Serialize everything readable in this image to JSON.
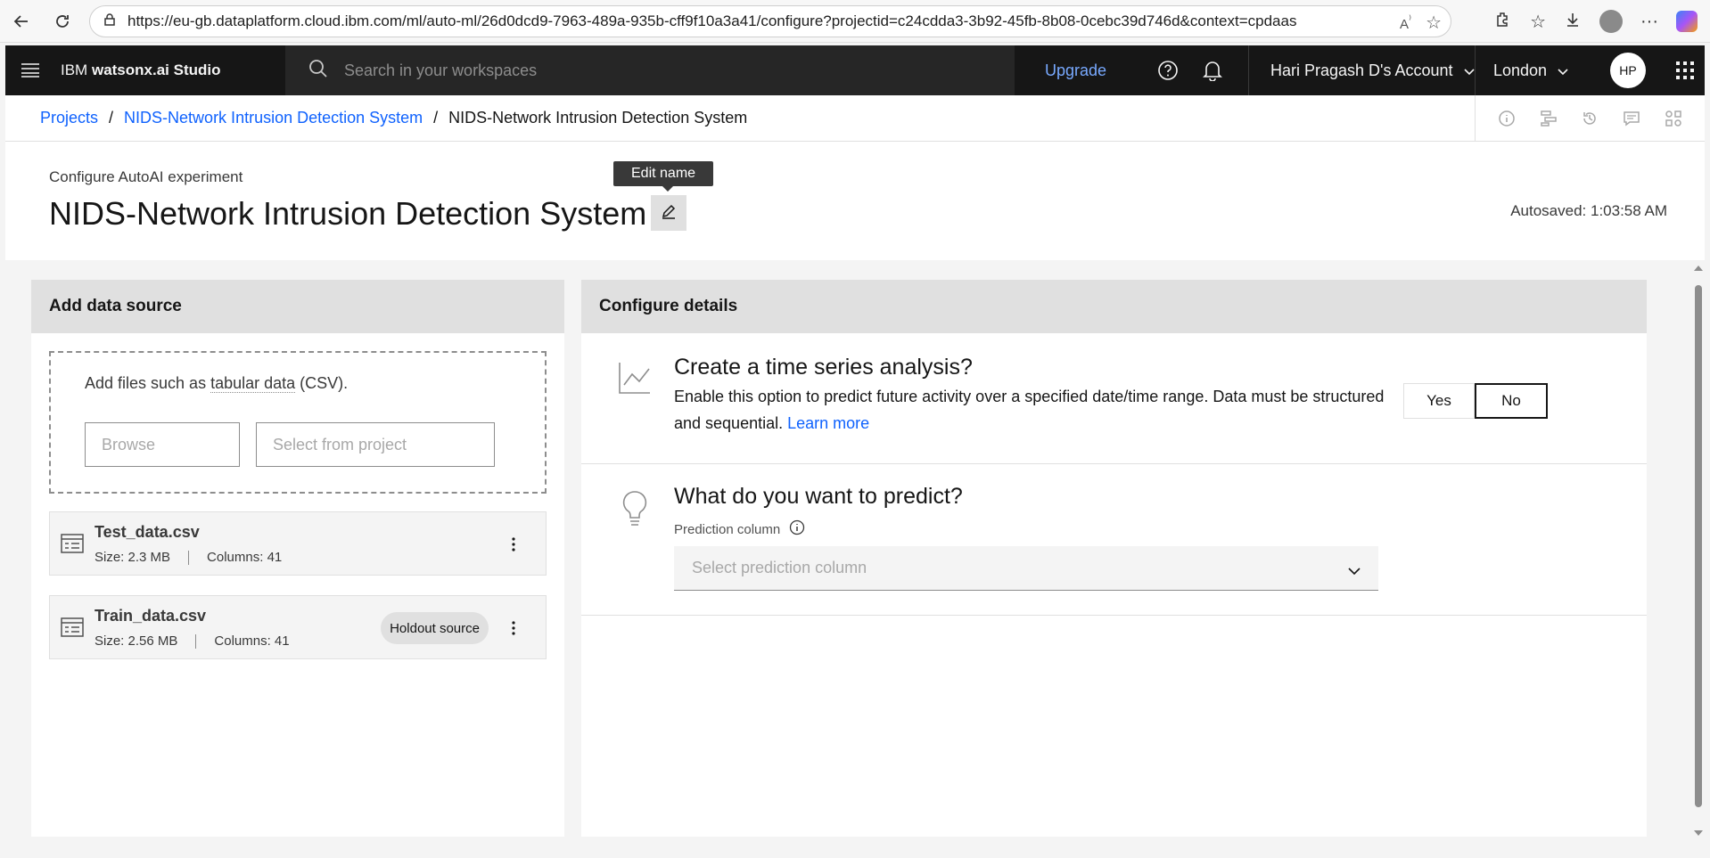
{
  "browser": {
    "url": "https://eu-gb.dataplatform.cloud.ibm.com/ml/auto-ml/26d0dcd9-7963-489a-935b-cff9f10a3a41/configure?projectid=c24cdda3-3b92-45fb-8b08-0cebc39d746d&context=cpdaas"
  },
  "header": {
    "product_prefix": "IBM",
    "product_name": "watsonx.ai Studio",
    "search_placeholder": "Search in your workspaces",
    "upgrade": "Upgrade",
    "account": "Hari Pragash D's Account",
    "region": "London",
    "avatar_initials": "HP"
  },
  "breadcrumb": {
    "items": [
      "Projects",
      "NIDS-Network Intrusion Detection System",
      "NIDS-Network Intrusion Detection System"
    ],
    "separator": "/"
  },
  "title_area": {
    "subtitle": "Configure AutoAI experiment",
    "title": "NIDS-Network Intrusion Detection System",
    "edit_tooltip": "Edit name",
    "autosaved": "Autosaved: 1:03:58 AM"
  },
  "data_source": {
    "heading": "Add data source",
    "dropzone_prefix": "Add files such as ",
    "dropzone_link": "tabular data",
    "dropzone_suffix": " (CSV).",
    "browse": "Browse",
    "select_from_project": "Select from project",
    "files": [
      {
        "name": "Test_data.csv",
        "size": "Size: 2.3 MB",
        "columns": "Columns: 41",
        "tag": ""
      },
      {
        "name": "Train_data.csv",
        "size": "Size: 2.56 MB",
        "columns": "Columns: 41",
        "tag": "Holdout source"
      }
    ]
  },
  "configure": {
    "heading": "Configure details",
    "time_series": {
      "title": "Create a time series analysis?",
      "description": "Enable this option to predict future activity over a specified date/time range. Data must be structured and sequential.",
      "learn_more": "Learn more",
      "yes": "Yes",
      "no": "No",
      "selected": "No"
    },
    "predict": {
      "title": "What do you want to predict?",
      "label": "Prediction column",
      "placeholder": "Select prediction column"
    }
  }
}
